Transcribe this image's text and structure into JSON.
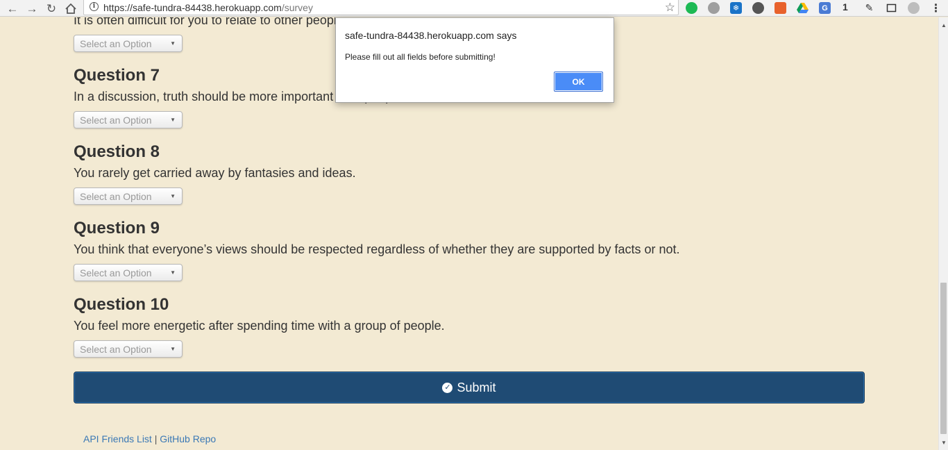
{
  "browser": {
    "url_host": "https://safe-tundra-84438.herokuapp.com",
    "url_path": "/survey",
    "extension_count": "1"
  },
  "survey": {
    "partial_question_text": "It is often difficult for you to relate to other people.",
    "select_placeholder": "Select an Option",
    "questions": [
      {
        "title": "Question 7",
        "text": "In a discussion, truth should be more important than people's sensitivities."
      },
      {
        "title": "Question 8",
        "text": "You rarely get carried away by fantasies and ideas."
      },
      {
        "title": "Question 9",
        "text": "You think that everyone’s views should be respected regardless of whether they are supported by facts or not."
      },
      {
        "title": "Question 10",
        "text": "You feel more energetic after spending time with a group of people."
      }
    ],
    "submit_label": "Submit"
  },
  "footer": {
    "api_link": "API Friends List",
    "separator": "|",
    "github_link": "GitHub Repo"
  },
  "dialog": {
    "title": "safe-tundra-84438.herokuapp.com says",
    "message": "Please fill out all fields before submitting!",
    "ok_label": "OK"
  },
  "colors": {
    "page_background": "#f3ead3",
    "submit_background": "#1f4b74",
    "dialog_ok": "#4a8cf7",
    "link": "#3a78b5"
  }
}
